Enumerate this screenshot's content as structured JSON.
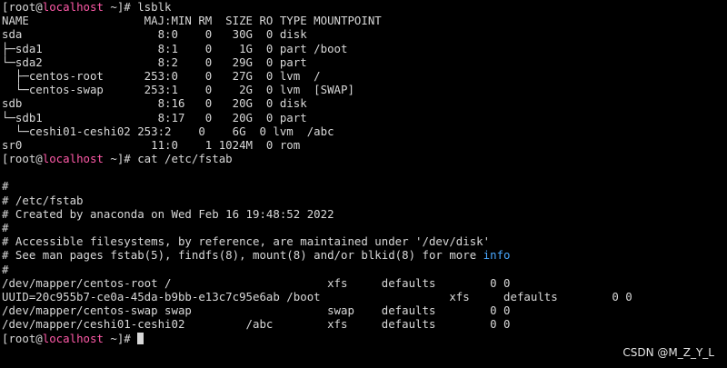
{
  "terminal": {
    "lines": [
      [
        {
          "t": "[root@"
        },
        {
          "t": "localhost",
          "c": "hl"
        },
        {
          "t": " ~]# lsblk"
        }
      ],
      [
        {
          "t": "NAME                 MAJ:MIN RM  SIZE RO TYPE MOUNTPOINT"
        }
      ],
      [
        {
          "t": "sda                    8:0    0   30G  0 disk"
        }
      ],
      [
        {
          "t": "├─sda1                 8:1    0    1G  0 part /boot"
        }
      ],
      [
        {
          "t": "└─sda2                 8:2    0   29G  0 part"
        }
      ],
      [
        {
          "t": "  ├─centos-root      253:0    0   27G  0 lvm  /"
        }
      ],
      [
        {
          "t": "  └─centos-swap      253:1    0    2G  0 lvm  [SWAP]"
        }
      ],
      [
        {
          "t": "sdb                    8:16   0   20G  0 disk"
        }
      ],
      [
        {
          "t": "└─sdb1                 8:17   0   20G  0 part"
        }
      ],
      [
        {
          "t": "  └─ceshi01-ceshi02 253:2    0    6G  0 lvm  /abc"
        }
      ],
      [
        {
          "t": "sr0                   11:0    1 1024M  0 rom"
        }
      ],
      [
        {
          "t": "[root@"
        },
        {
          "t": "localhost",
          "c": "hl"
        },
        {
          "t": " ~]# cat /etc/fstab"
        }
      ],
      [
        {
          "t": ""
        }
      ],
      [
        {
          "t": "#"
        }
      ],
      [
        {
          "t": "# /etc/fstab"
        }
      ],
      [
        {
          "t": "# Created by anaconda on Wed Feb 16 19:48:52 2022"
        }
      ],
      [
        {
          "t": "#"
        }
      ],
      [
        {
          "t": "# Accessible filesystems, by reference, are maintained under '/dev/disk'"
        }
      ],
      [
        {
          "t": "# See man pages fstab(5), findfs(8), mount(8) and/or blkid(8) for more "
        },
        {
          "t": "info",
          "c": "kw"
        }
      ],
      [
        {
          "t": "#"
        }
      ],
      [
        {
          "t": "/dev/mapper/centos-root /                       xfs     defaults        0 0"
        }
      ],
      [
        {
          "t": "UUID=20c955b7-ce0a-45da-b9bb-e13c7c95e6ab /boot                   xfs     defaults        0 0"
        }
      ],
      [
        {
          "t": "/dev/mapper/centos-swap swap                    swap    defaults        0 0"
        }
      ],
      [
        {
          "t": "/dev/mapper/ceshi01-ceshi02         /abc        xfs     defaults        0 0"
        }
      ],
      [
        {
          "t": "[root@"
        },
        {
          "t": "localhost",
          "c": "hl"
        },
        {
          "t": " ~]# "
        }
      ]
    ]
  },
  "watermark": "CSDN @M_Z_Y_L"
}
